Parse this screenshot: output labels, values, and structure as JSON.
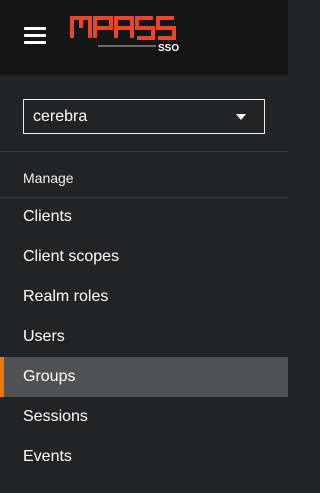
{
  "header": {
    "menu_icon": "hamburger-icon",
    "logo": {
      "main_text": "MPASS",
      "sub_text": "SSO",
      "accent_color": "#e8452c"
    }
  },
  "realm_selector": {
    "selected": "cerebra"
  },
  "sidebar": {
    "section_title": "Manage",
    "items": [
      {
        "label": "Clients",
        "active": false
      },
      {
        "label": "Client scopes",
        "active": false
      },
      {
        "label": "Realm roles",
        "active": false
      },
      {
        "label": "Users",
        "active": false
      },
      {
        "label": "Groups",
        "active": true
      },
      {
        "label": "Sessions",
        "active": false
      },
      {
        "label": "Events",
        "active": false
      }
    ],
    "active_indicator_color": "#ec7a08"
  }
}
